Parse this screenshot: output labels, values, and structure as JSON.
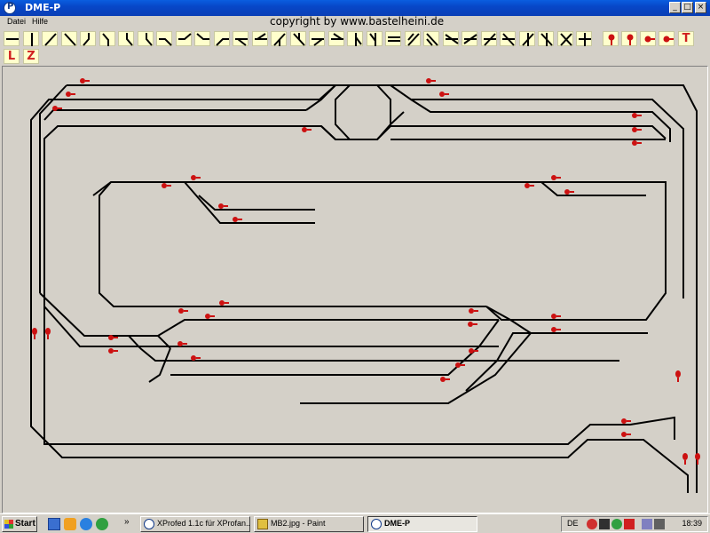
{
  "window": {
    "title": "DME-P",
    "minimize_glyph": "_",
    "maximize_glyph": "□",
    "close_glyph": "×"
  },
  "menu": {
    "items": [
      "Datei",
      "Hilfe"
    ]
  },
  "header": {
    "copyright": "copyright by www.bastelheini.de"
  },
  "toolbar": {
    "tool_icons": [
      "straight-horizontal-icon",
      "straight-vertical-icon",
      "diagonal-up-icon",
      "diagonal-down-icon",
      "curve-icon",
      "curve-icon",
      "curve-icon",
      "curve-icon",
      "curve-icon",
      "curve-icon",
      "curve-icon",
      "curve-icon",
      "switch-icon",
      "switch-icon",
      "switch-icon",
      "switch-icon",
      "switch-icon",
      "switch-icon",
      "switch-icon",
      "switch-icon",
      "switch-icon",
      "switch-icon",
      "switch-icon",
      "switch-icon",
      "switch-icon",
      "switch-icon",
      "switch-icon",
      "switch-icon",
      "switch-icon",
      "switch-icon",
      "switch-icon",
      "signal-vertical-icon",
      "signal-vertical-icon",
      "signal-horizontal-icon",
      "signal-horizontal-icon"
    ],
    "letter_buttons": [
      "T",
      "L",
      "Z"
    ]
  },
  "taskbar": {
    "start_label": "Start",
    "overflow_glyph": "»",
    "tasks": [
      {
        "label": "XProfed 1.1c für XProfan..."
      },
      {
        "label": "MB2.jpg - Paint"
      },
      {
        "label": "DME-P"
      }
    ],
    "language": "DE",
    "clock": "18:39"
  },
  "colors": {
    "titlebar": "#0a3fb5",
    "tool_bg": "#ffffcc",
    "signal": "#cc1111",
    "track": "#000000",
    "canvas": "#d4d0c8"
  }
}
